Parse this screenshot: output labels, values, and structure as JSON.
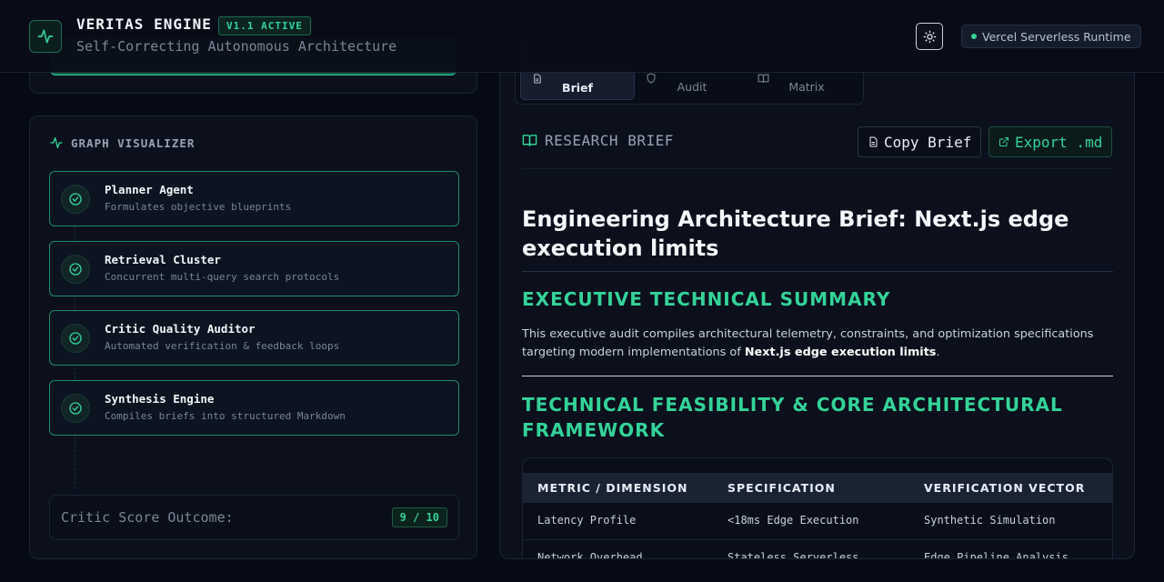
{
  "header": {
    "title": "VERITAS ENGINE",
    "version_badge": "V1.1 ACTIVE",
    "subtitle": "Self-Correcting Autonomous Architecture",
    "runtime_label": "Vercel Serverless Runtime"
  },
  "graph": {
    "title": "GRAPH VISUALIZER",
    "nodes": [
      {
        "title": "Planner Agent",
        "desc": "Formulates objective blueprints"
      },
      {
        "title": "Retrieval Cluster",
        "desc": "Concurrent multi-query search protocols"
      },
      {
        "title": "Critic Quality Auditor",
        "desc": "Automated verification & feedback loops"
      },
      {
        "title": "Synthesis Engine",
        "desc": "Compiles briefs into structured Markdown"
      }
    ],
    "score_label": "Critic Score Outcome:",
    "score_value": "9 / 10"
  },
  "tabs": [
    {
      "label": "Brief"
    },
    {
      "label": "Audit"
    },
    {
      "label": "Matrix"
    }
  ],
  "brief": {
    "section_label": "RESEARCH BRIEF",
    "copy_label": "Copy Brief",
    "export_label": "Export .md",
    "doc_title": "Engineering Architecture Brief: Next.js edge execution limits",
    "summary_heading": "EXECUTIVE TECHNICAL SUMMARY",
    "summary_text": "This executive audit compiles architectural telemetry, constraints, and optimization specifications targeting modern implementations of ",
    "summary_strong": "Next.js edge execution limits",
    "summary_end": ".",
    "feasibility_heading": "TECHNICAL FEASIBILITY & CORE ARCHITECTURAL FRAMEWORK",
    "table": {
      "headers": [
        "METRIC / DIMENSION",
        "SPECIFICATION",
        "VERIFICATION VECTOR"
      ],
      "rows": [
        [
          "Latency Profile",
          "<18ms Edge Execution",
          "Synthetic Simulation"
        ],
        [
          "Network Overhead",
          "Stateless Serverless",
          "Edge Pipeline Analysis"
        ]
      ]
    }
  },
  "colors": {
    "accent": "#34d399",
    "background": "#060a14",
    "card": "#0b101c",
    "node_border": "#1f8a68"
  }
}
